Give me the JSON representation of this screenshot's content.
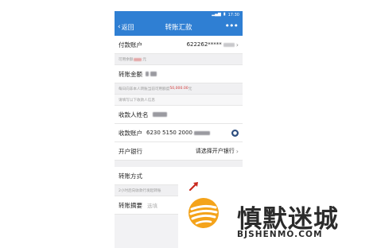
{
  "status_bar": {
    "time": "17:30"
  },
  "header": {
    "back_label": "返回",
    "title": "转账汇款",
    "more_label": "•••"
  },
  "payer": {
    "label": "付款账户",
    "account": "622262*****"
  },
  "available": {
    "text": "可用余额",
    "amount_suffix": "元"
  },
  "amount": {
    "label": "转账金额"
  },
  "limit_note": {
    "prefix": "每日向非本人转账当前可用额度",
    "limit": "50,000.00",
    "suffix": "元"
  },
  "payee_hint": {
    "text": "请填写以下收款人信息"
  },
  "payee_name": {
    "label": "收款人姓名"
  },
  "payee_account": {
    "label": "收款账户",
    "value": "6230 5150 2000"
  },
  "bank": {
    "label": "开户银行",
    "placeholder": "请选择开户银行"
  },
  "method": {
    "label": "转账方式",
    "note": "2小时后向收款行发起转账"
  },
  "memo": {
    "label": "转账摘要",
    "placeholder": "选填"
  },
  "watermark": {
    "name": "慎默迷城",
    "domain": "BJSHENMO.COM"
  },
  "colors": {
    "brand_blue": "#2f7fd3",
    "warning_red": "#d23a3a",
    "logo_orange": "#f4a31a"
  }
}
